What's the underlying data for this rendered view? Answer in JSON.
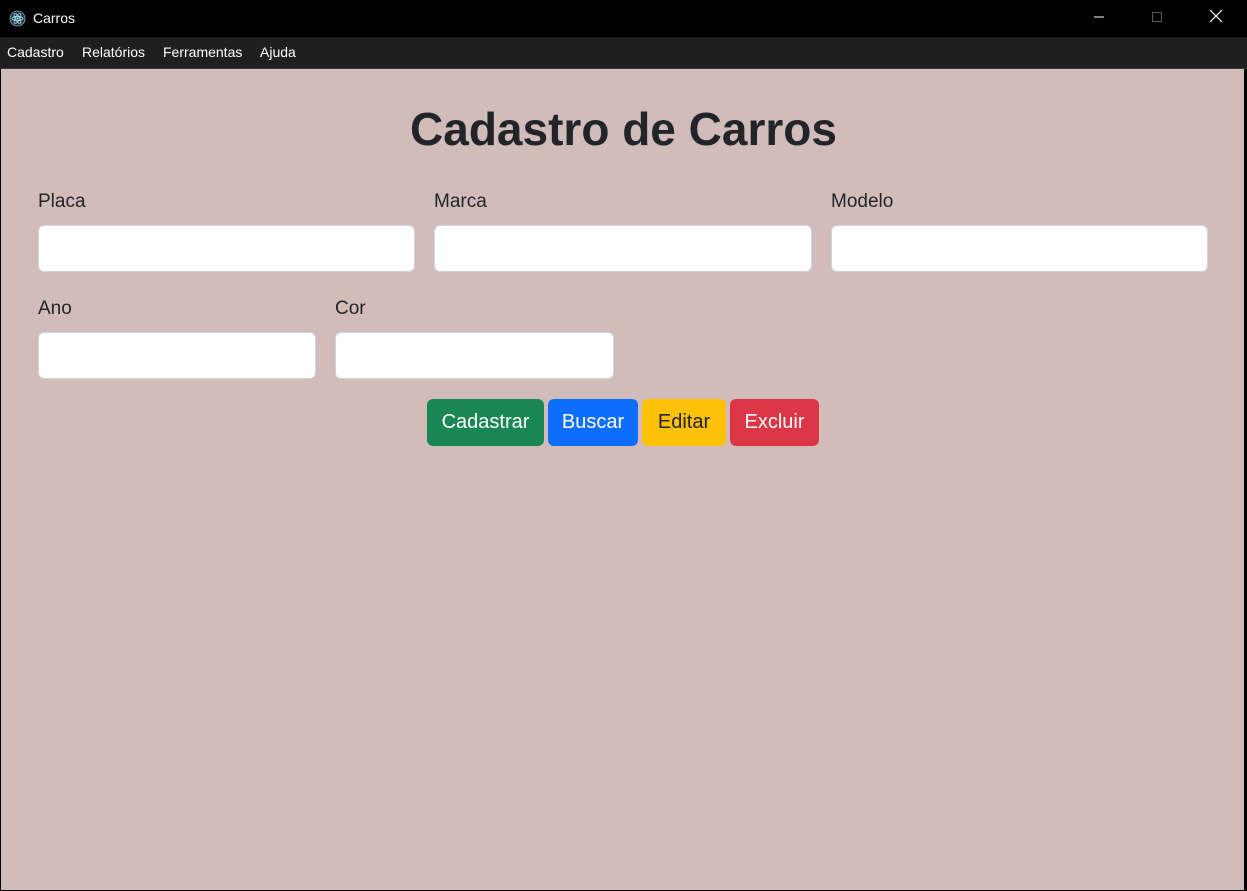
{
  "window": {
    "title": "Carros",
    "icon": "electron-atom-icon",
    "controls": [
      "minimize-icon",
      "maximize-icon",
      "close-icon"
    ]
  },
  "menu": {
    "items": [
      "Cadastro",
      "Relatórios",
      "Ferramentas",
      "Ajuda"
    ]
  },
  "form": {
    "title": "Cadastro de Carros",
    "fields": {
      "placa": {
        "label": "Placa",
        "value": ""
      },
      "marca": {
        "label": "Marca",
        "value": ""
      },
      "modelo": {
        "label": "Modelo",
        "value": ""
      },
      "ano": {
        "label": "Ano",
        "value": ""
      },
      "cor": {
        "label": "Cor",
        "value": ""
      }
    },
    "buttons": {
      "cadastrar": "Cadastrar",
      "buscar": "Buscar",
      "editar": "Editar",
      "excluir": "Excluir"
    }
  },
  "colors": {
    "background": "#d2bcba",
    "success": "#198754",
    "primary": "#0d6efd",
    "warning": "#ffc107",
    "danger": "#dc3545"
  }
}
